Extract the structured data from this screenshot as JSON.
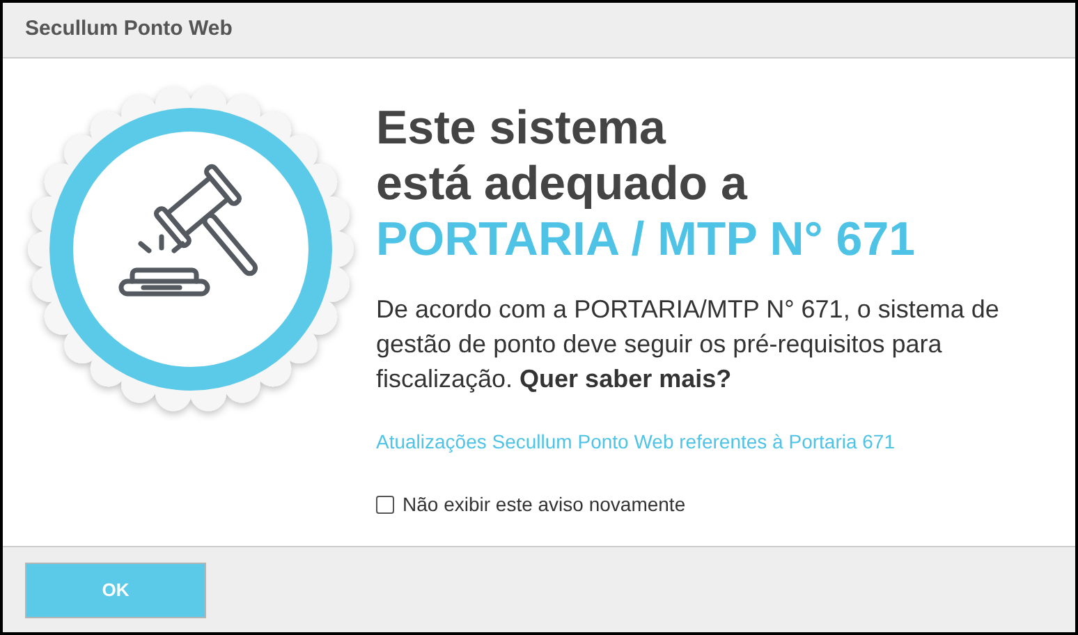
{
  "window": {
    "title": "Secullum Ponto Web"
  },
  "heading": {
    "lines": [
      "Este sistema",
      "está adequado a"
    ],
    "highlight": "PORTARIA / MTP N° 671"
  },
  "description": "De acordo com a PORTARIA/MTP N° 671, o sistema de gestão de ponto deve seguir os pré-requisitos para fiscalização. **Quer saber mais?**",
  "link": "Atualizações Secullum Ponto Web referentes à Portaria 671",
  "dont_show_again": {
    "label": "Não exibir este aviso novamente",
    "checked": false
  },
  "buttons": [
    "OK"
  ]
}
